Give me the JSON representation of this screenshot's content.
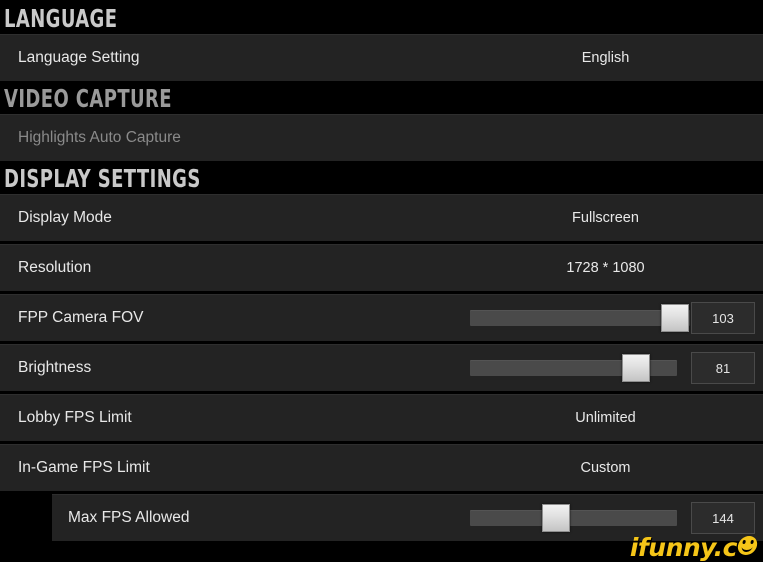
{
  "theme": {
    "background": "#000000",
    "row_background": "#232323",
    "text_primary": "#e8e8e8",
    "text_disabled": "#8a8a8a",
    "header_text": "#c9c9c9",
    "slider_track": "#4a4a4a",
    "slider_handle": "#e0e0e0",
    "watermark_color": "#f5c518"
  },
  "sections": [
    {
      "id": "language",
      "title": "LANGUAGE",
      "dim": false,
      "rows": [
        {
          "id": "language-setting",
          "label": "Language Setting",
          "type": "value",
          "value": "English",
          "disabled": false,
          "indented": false
        }
      ]
    },
    {
      "id": "video-capture",
      "title": "VIDEO CAPTURE",
      "dim": true,
      "rows": [
        {
          "id": "highlights-auto-capture",
          "label": "Highlights Auto Capture",
          "type": "value",
          "value": "",
          "disabled": true,
          "indented": false
        }
      ]
    },
    {
      "id": "display-settings",
      "title": "DISPLAY SETTINGS",
      "dim": false,
      "rows": [
        {
          "id": "display-mode",
          "label": "Display Mode",
          "type": "value",
          "value": "Fullscreen",
          "disabled": false,
          "indented": false
        },
        {
          "id": "resolution",
          "label": "Resolution",
          "type": "value",
          "value": "1728 * 1080",
          "disabled": false,
          "indented": false
        },
        {
          "id": "fpp-camera-fov",
          "label": "FPP Camera FOV",
          "type": "slider",
          "value": "103",
          "fill_percent": 96,
          "disabled": false,
          "indented": false
        },
        {
          "id": "brightness",
          "label": "Brightness",
          "type": "slider",
          "value": "81",
          "fill_percent": 80,
          "disabled": false,
          "indented": false
        },
        {
          "id": "lobby-fps-limit",
          "label": "Lobby FPS Limit",
          "type": "value",
          "value": "Unlimited",
          "disabled": false,
          "indented": false
        },
        {
          "id": "in-game-fps-limit",
          "label": "In-Game FPS Limit",
          "type": "value",
          "value": "Custom",
          "disabled": false,
          "indented": false
        },
        {
          "id": "max-fps-allowed",
          "label": "Max FPS Allowed",
          "type": "slider",
          "value": "144",
          "fill_percent": 41,
          "disabled": false,
          "indented": true
        }
      ]
    }
  ],
  "watermark": {
    "text": "ifunny.c",
    "icon": "smiley-face-icon"
  }
}
